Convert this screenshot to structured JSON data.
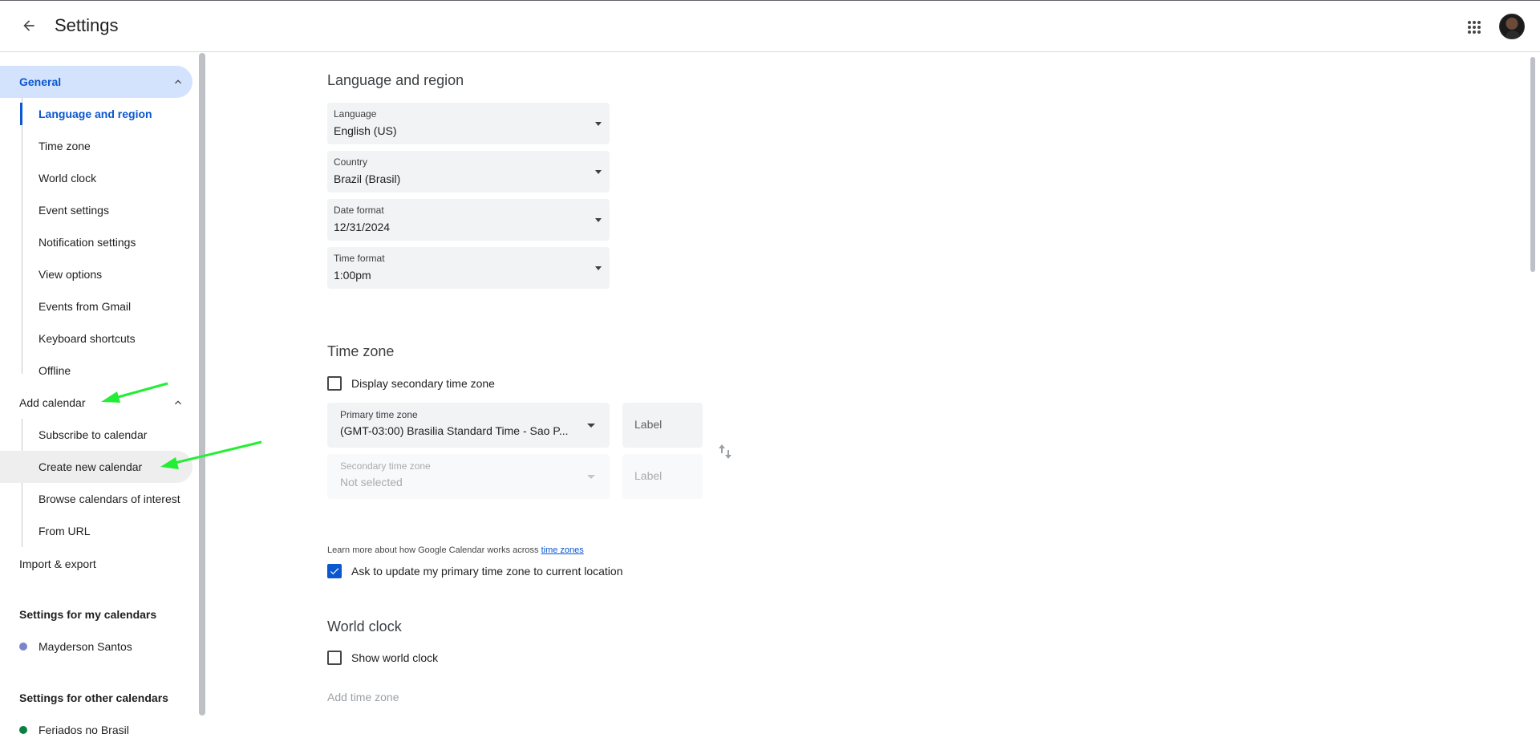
{
  "header": {
    "title": "Settings",
    "back_icon": "arrow-back-icon",
    "apps_icon": "google-apps-icon",
    "avatar": "account-avatar"
  },
  "sidebar": {
    "general": {
      "label": "General",
      "items": [
        {
          "label": "Language and region",
          "active": true
        },
        {
          "label": "Time zone"
        },
        {
          "label": "World clock"
        },
        {
          "label": "Event settings"
        },
        {
          "label": "Notification settings"
        },
        {
          "label": "View options"
        },
        {
          "label": "Events from Gmail"
        },
        {
          "label": "Keyboard shortcuts"
        },
        {
          "label": "Offline"
        }
      ]
    },
    "add_calendar": {
      "label": "Add calendar",
      "items": [
        {
          "label": "Subscribe to calendar"
        },
        {
          "label": "Create new calendar",
          "hovered": true
        },
        {
          "label": "Browse calendars of interest"
        },
        {
          "label": "From URL"
        }
      ]
    },
    "import_export": "Import & export",
    "my_calendars_heading": "Settings for my calendars",
    "my_calendars": [
      {
        "label": "Mayderson Santos",
        "color": "#7986cb"
      }
    ],
    "other_calendars_heading": "Settings for other calendars",
    "other_calendars": [
      {
        "label": "Feriados no Brasil",
        "color": "#0b8043"
      }
    ]
  },
  "main": {
    "language_region": {
      "title": "Language and region",
      "fields": [
        {
          "label": "Language",
          "value": "English (US)"
        },
        {
          "label": "Country",
          "value": "Brazil (Brasil)"
        },
        {
          "label": "Date format",
          "value": "12/31/2024"
        },
        {
          "label": "Time format",
          "value": "1:00pm"
        }
      ]
    },
    "time_zone": {
      "title": "Time zone",
      "display_secondary_label": "Display secondary time zone",
      "display_secondary_checked": false,
      "primary_label": "Primary time zone",
      "primary_value": "(GMT-03:00) Brasilia Standard Time - Sao P...",
      "primary_tz_label_placeholder": "Label",
      "secondary_label": "Secondary time zone",
      "secondary_value": "Not selected",
      "secondary_tz_label_placeholder": "Label",
      "ask_update_label": "Ask to update my primary time zone to current location",
      "ask_update_checked": true,
      "help_text": "Learn more about how Google Calendar works across ",
      "help_link": "time zones"
    },
    "world_clock": {
      "title": "World clock",
      "show_label": "Show world clock",
      "show_checked": false,
      "add_time_zone": "Add time zone"
    }
  },
  "colors": {
    "accent": "#0b57d0",
    "selected_bg": "#d3e3fd",
    "annotation_arrow": "#22ee33"
  }
}
